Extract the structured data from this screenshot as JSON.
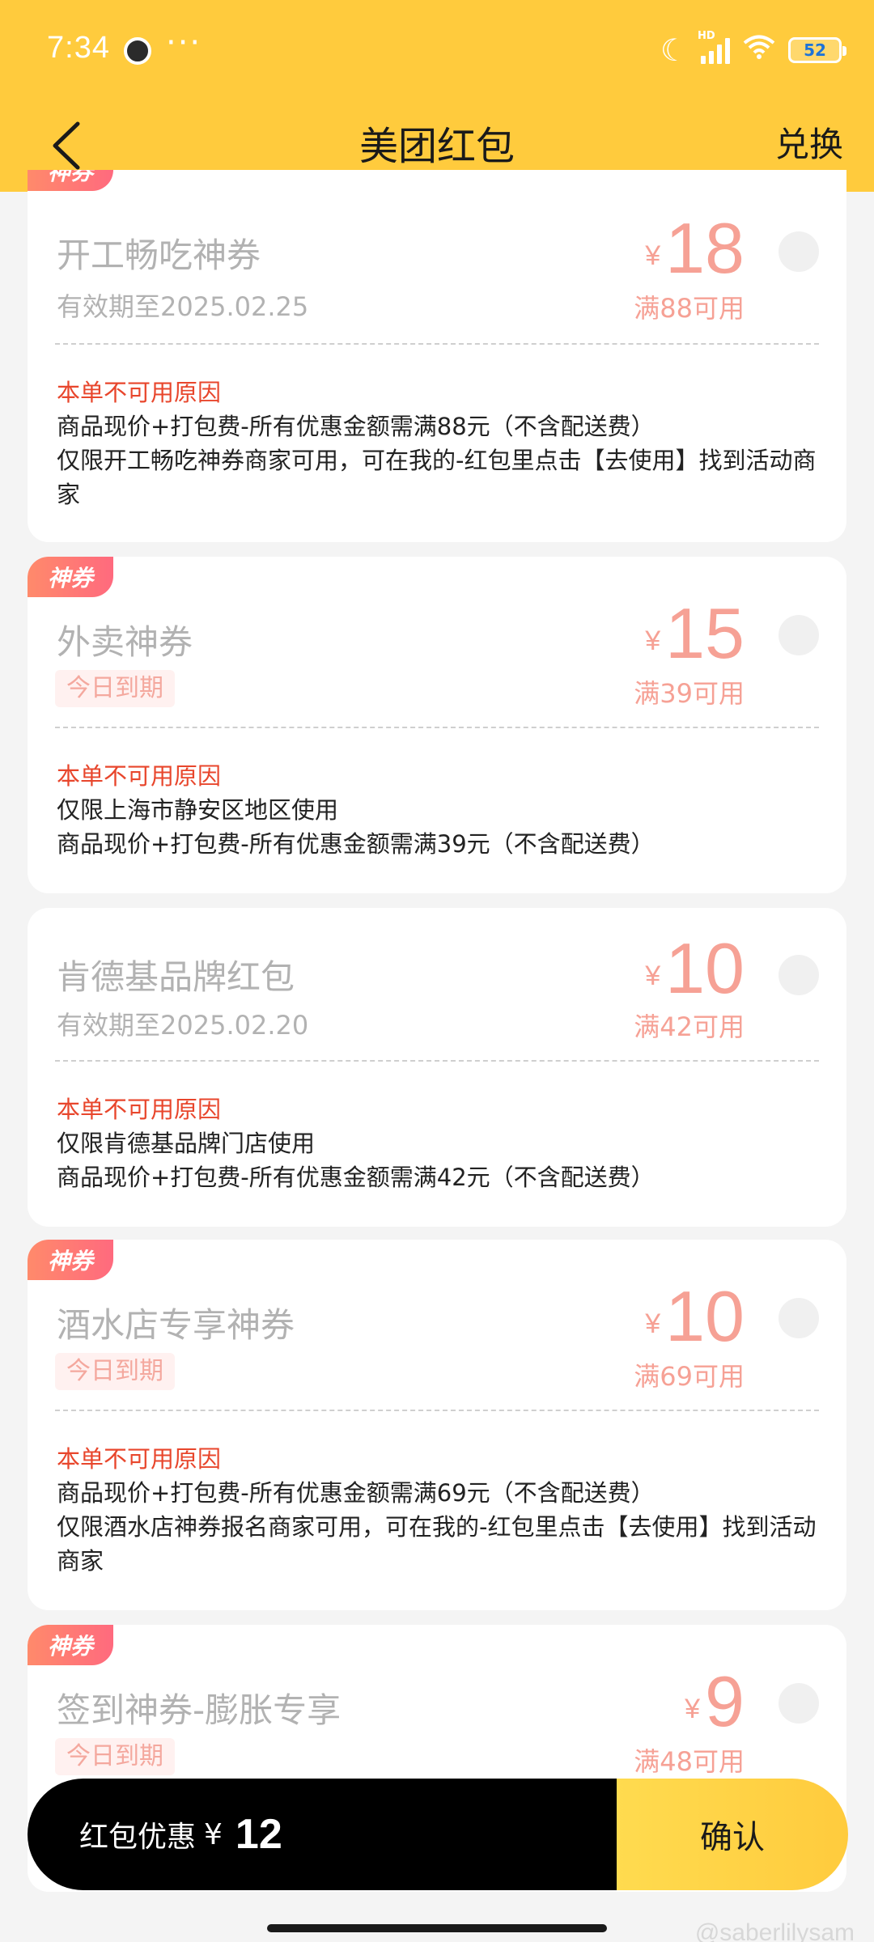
{
  "status": {
    "time": "7:34",
    "more": "···",
    "network": "HD",
    "battery": "52"
  },
  "header": {
    "title": "美团红包",
    "redeem_label": "兑换"
  },
  "tag_label": "神券",
  "cards": [
    {
      "title": "开工畅吃神券",
      "subtitle": "有效期至2025.02.25",
      "currency": "¥",
      "amount": "18",
      "condition": "满88可用",
      "reason_title": "本单不可用原因",
      "reasons": [
        "商品现价+打包费-所有优惠金额需满88元（不含配送费）",
        "仅限开工畅吃神券商家可用，可在我的-红包里点击【去使用】找到活动商家"
      ]
    },
    {
      "title": "外卖神券",
      "badge": "今日到期",
      "currency": "¥",
      "amount": "15",
      "condition": "满39可用",
      "reason_title": "本单不可用原因",
      "reasons": [
        "仅限上海市静安区地区使用",
        "商品现价+打包费-所有优惠金额需满39元（不含配送费）"
      ]
    },
    {
      "title": "肯德基品牌红包",
      "subtitle": "有效期至2025.02.20",
      "currency": "¥",
      "amount": "10",
      "condition": "满42可用",
      "reason_title": "本单不可用原因",
      "reasons": [
        "仅限肯德基品牌门店使用",
        "商品现价+打包费-所有优惠金额需满42元（不含配送费）"
      ]
    },
    {
      "title": "酒水店专享神券",
      "badge": "今日到期",
      "currency": "¥",
      "amount": "10",
      "condition": "满69可用",
      "reason_title": "本单不可用原因",
      "reasons": [
        "商品现价+打包费-所有优惠金额需满69元（不含配送费）",
        "仅限酒水店神券报名商家可用，可在我的-红包里点击【去使用】找到活动商家"
      ]
    },
    {
      "title": "签到神券-膨胀专享",
      "badge": "今日到期",
      "currency": "¥",
      "amount": "9",
      "condition": "满48可用"
    }
  ],
  "bottom": {
    "label": "红包优惠",
    "currency": "¥",
    "value": "12",
    "confirm_label": "确认"
  },
  "watermark": "@saberlilysam",
  "colors": {
    "header_bg": "#ffcb3d",
    "amount": "#f6a195",
    "reason_title": "#e8462c",
    "tag": "#ff7a74"
  }
}
